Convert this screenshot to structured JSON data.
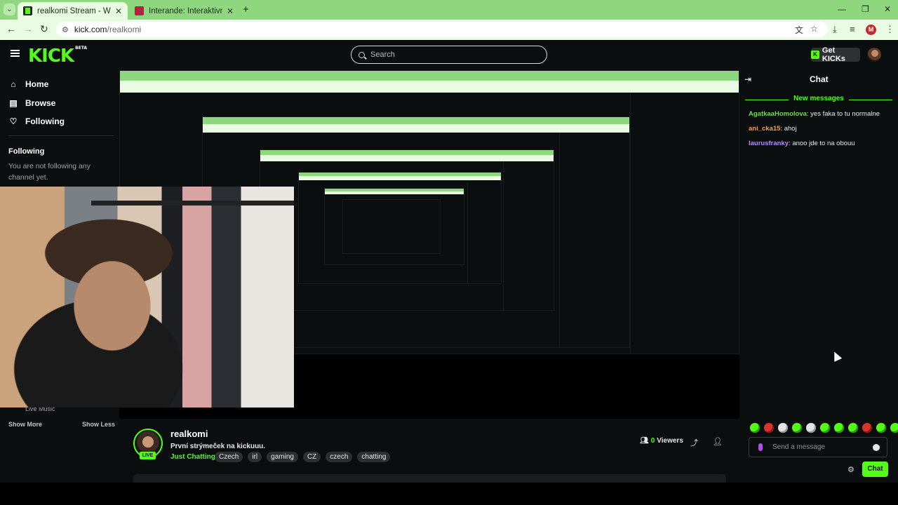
{
  "browser": {
    "tabs": [
      {
        "title": "realkomi Stream - Watch Live o",
        "active": true
      },
      {
        "title": "Interande: Interaktivní film, co",
        "active": false
      }
    ],
    "url_host": "kick.com",
    "url_path": "/realkomi",
    "profile_initial": "M"
  },
  "header": {
    "logo": "KICK",
    "logo_badge": "BETA",
    "search_placeholder": "Search",
    "get_kicks": "Get KICKs"
  },
  "sidebar": {
    "nav": [
      {
        "label": "Home",
        "icon": "home-icon"
      },
      {
        "label": "Browse",
        "icon": "browse-icon"
      },
      {
        "label": "Following",
        "icon": "heart-icon"
      }
    ],
    "following_title": "Following",
    "following_empty": "You are not following any channel yet.",
    "live_music": "Live Music",
    "show_more": "Show More",
    "show_less": "Show Less"
  },
  "chat": {
    "title": "Chat",
    "new_messages": "New messages",
    "messages": [
      {
        "user": "AgatkaaHomolova",
        "color": "#7dd64f",
        "text": "yes faka to tu normalne"
      },
      {
        "user": "ani_cka15",
        "color": "#ff9f43",
        "text": "ahoj"
      },
      {
        "user": "laurusfranky",
        "color": "#b48cff",
        "text": "anoo jde to na obouu"
      }
    ],
    "send_placeholder": "Send a message",
    "chat_button": "Chat"
  },
  "stream": {
    "name": "realkomi",
    "title": "První strýmeček na kickuuu.",
    "category": "Just Chatting",
    "tags": [
      "Czech",
      "irl",
      "gaming",
      "CZ",
      "czech",
      "chatting"
    ],
    "live": "LIVE",
    "viewers_count": "0",
    "viewers_label": "Viewers"
  },
  "colors": {
    "accent": "#53fc18",
    "background": "#0b0e0f",
    "browser_frame": "#8fd77e"
  }
}
